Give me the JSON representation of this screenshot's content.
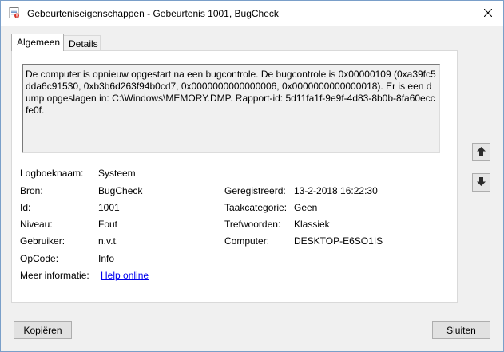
{
  "window": {
    "title": "Gebeurteniseigenschappen - Gebeurtenis 1001, BugCheck"
  },
  "tabs": [
    {
      "label": "Algemeen",
      "active": true
    },
    {
      "label": "Details",
      "active": false
    }
  ],
  "description": "De computer is opnieuw opgestart na een bugcontrole. De bugcontrole is 0x00000109 (0xa39fc5dda6c91530, 0xb3b6d263f94b0cd7, 0x0000000000000006, 0x0000000000000018). Er is een dump opgeslagen in: C:\\Windows\\MEMORY.DMP. Rapport-id: 5d11fa1f-9e9f-4d83-8b0b-8fa60eccfe0f.",
  "fields": {
    "log_name": {
      "label": "Logboeknaam:",
      "value": "Systeem"
    },
    "source": {
      "label": "Bron:",
      "value": "BugCheck"
    },
    "event_id": {
      "label": "Id:",
      "value": "1001"
    },
    "level": {
      "label": "Niveau:",
      "value": "Fout"
    },
    "user": {
      "label": "Gebruiker:",
      "value": "n.v.t."
    },
    "opcode": {
      "label": "OpCode:",
      "value": "Info"
    },
    "more_info": {
      "label": "Meer informatie:",
      "value": "Help online"
    },
    "logged": {
      "label": "Geregistreerd:",
      "value": "13-2-2018 16:22:30"
    },
    "task_category": {
      "label": "Taakcategorie:",
      "value": "Geen"
    },
    "keywords": {
      "label": "Trefwoorden:",
      "value": "Klassiek"
    },
    "computer": {
      "label": "Computer:",
      "value": "DESKTOP-E6SO1IS"
    }
  },
  "buttons": {
    "copy": "Kopiëren",
    "close": "Sluiten"
  },
  "icons": {
    "app": "event-viewer-icon",
    "close": "close-icon",
    "up": "arrow-up-icon",
    "down": "arrow-down-icon"
  },
  "colors": {
    "link": "#0000ee",
    "window_border": "#7a9fc9",
    "dialog_bg": "#f0f0f0"
  }
}
